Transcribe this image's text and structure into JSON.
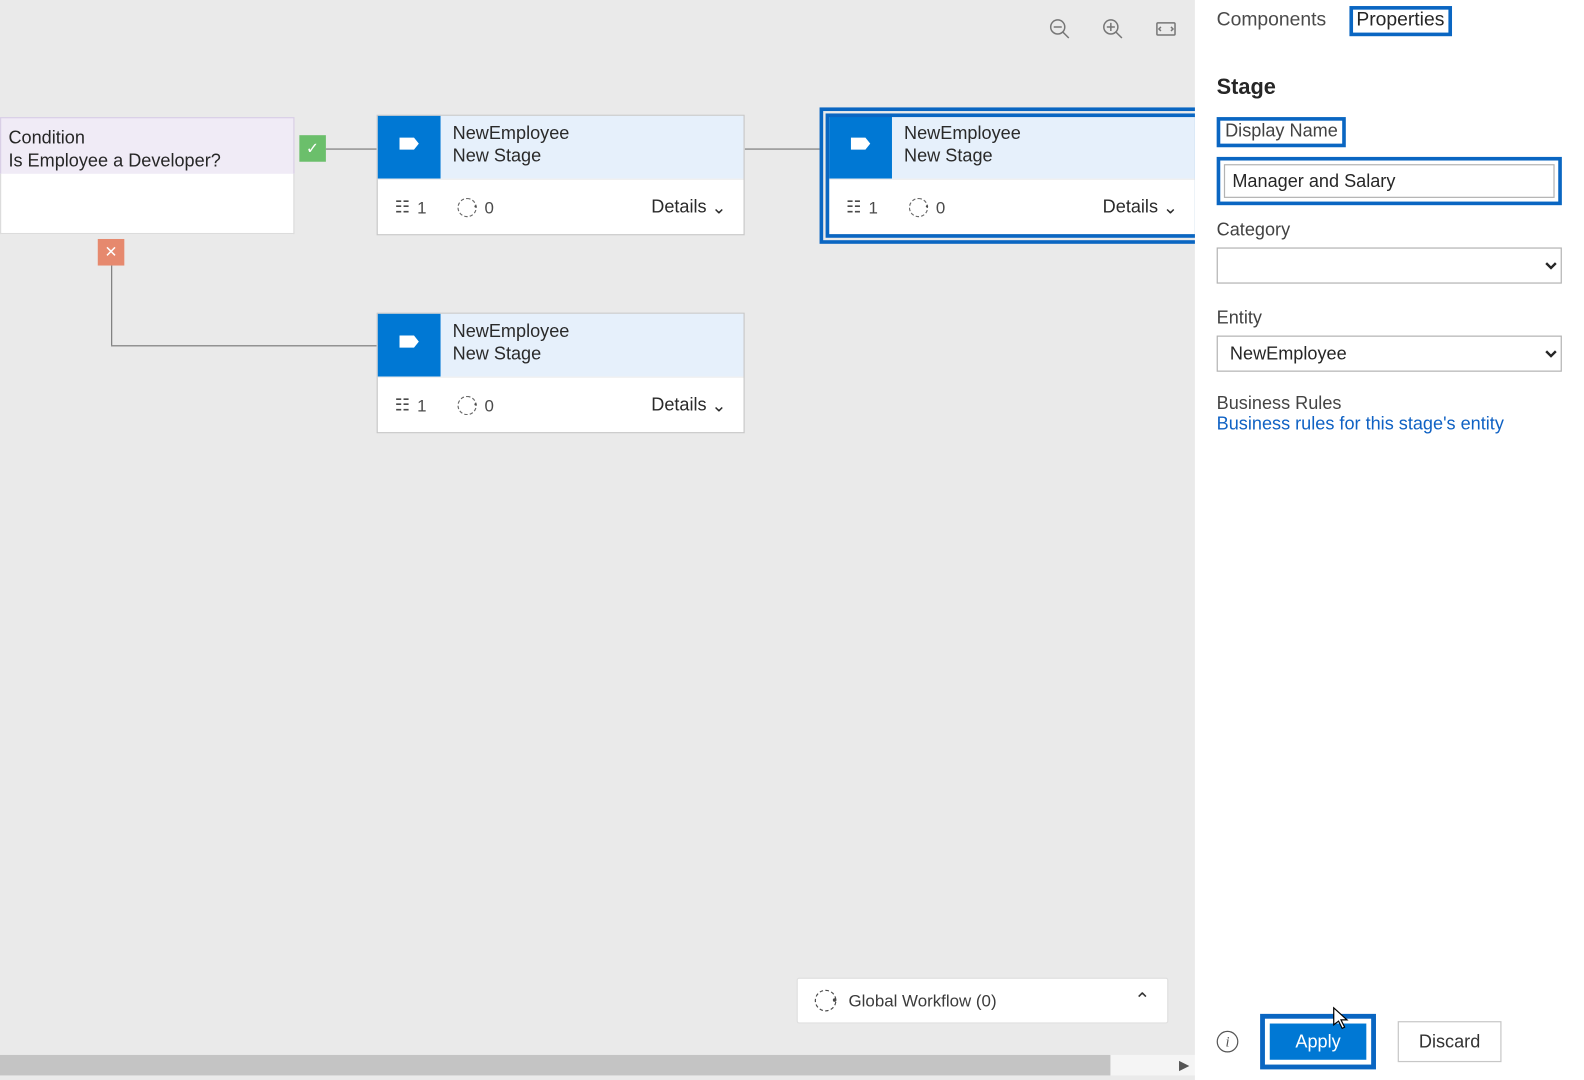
{
  "tabs": {
    "components": "Components",
    "properties": "Properties"
  },
  "panel": {
    "heading": "Stage",
    "display_name_label": "Display Name",
    "display_name_value": "Manager and Salary",
    "category_label": "Category",
    "category_value": "",
    "entity_label": "Entity",
    "entity_value": "NewEmployee",
    "business_rules_label": "Business Rules",
    "business_rules_link": "Business rules for this stage's entity",
    "apply": "Apply",
    "discard": "Discard"
  },
  "condition": {
    "title": "Condition",
    "question": "Is Employee a Developer?"
  },
  "stages": [
    {
      "title": "NewEmployee",
      "subtitle": "New Stage",
      "steps": "1",
      "workflows": "0",
      "details": "Details"
    },
    {
      "title": "NewEmployee",
      "subtitle": "New Stage",
      "steps": "1",
      "workflows": "0",
      "details": "Details"
    },
    {
      "title": "NewEmployee",
      "subtitle": "New Stage",
      "steps": "1",
      "workflows": "0",
      "details": "Details"
    }
  ],
  "global_workflow": {
    "label": "Global Workflow (0)"
  },
  "icons": {
    "yes": "✓",
    "no": "✕",
    "steps_glyph": "☷",
    "chevron_down": "⌄",
    "chevron_up": "⌃",
    "right_arrow": "▶",
    "info": "i"
  }
}
